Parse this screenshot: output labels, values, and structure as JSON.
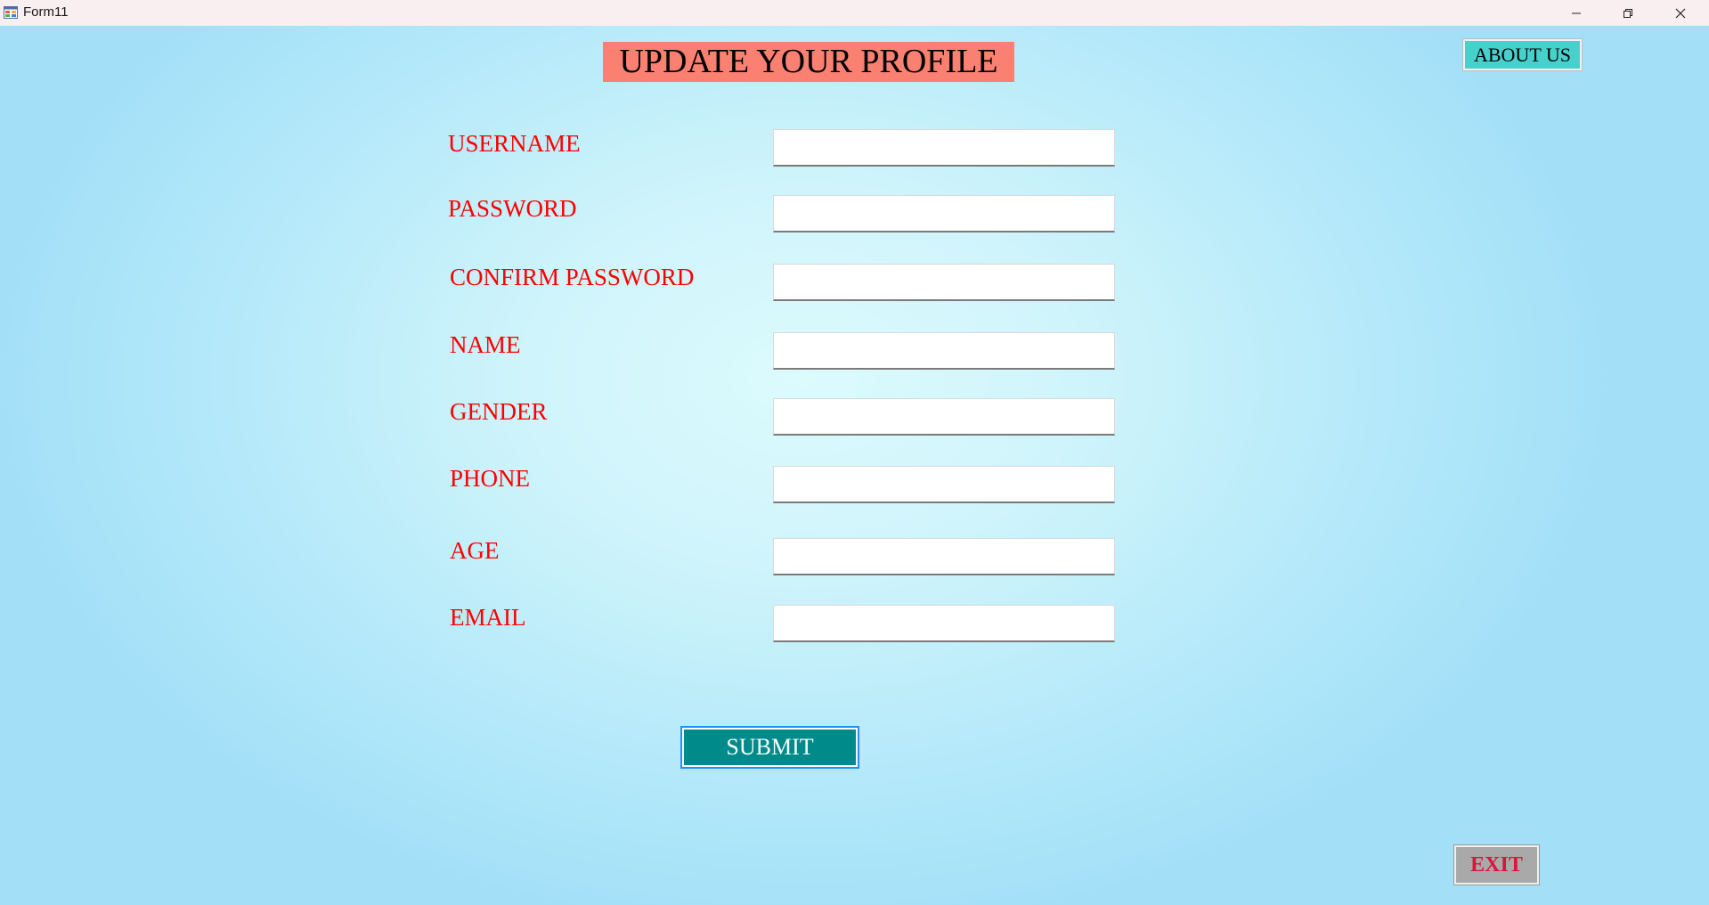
{
  "window": {
    "title": "Form11",
    "app_icon": "form-app-icon",
    "controls": {
      "minimize_icon": "minimize-icon",
      "maximize_icon": "restore-icon",
      "close_icon": "close-icon"
    }
  },
  "header": {
    "title": "UPDATE YOUR PROFILE",
    "about_label": "ABOUT US"
  },
  "form": {
    "fields": [
      {
        "label": "USERNAME",
        "value": ""
      },
      {
        "label": "PASSWORD",
        "value": ""
      },
      {
        "label": "CONFIRM PASSWORD",
        "value": ""
      },
      {
        "label": "NAME",
        "value": ""
      },
      {
        "label": "GENDER",
        "value": ""
      },
      {
        "label": "PHONE",
        "value": ""
      },
      {
        "label": "AGE",
        "value": ""
      },
      {
        "label": "EMAIL",
        "value": ""
      }
    ],
    "submit_label": "SUBMIT"
  },
  "footer": {
    "exit_label": "EXIT"
  },
  "colors": {
    "title_bg": "#fa8072",
    "label_text": "#ff0000",
    "about_bg": "#48d1cc",
    "submit_bg": "#008b8b",
    "exit_bg": "#a9a9a9",
    "exit_text": "#dc143c"
  }
}
